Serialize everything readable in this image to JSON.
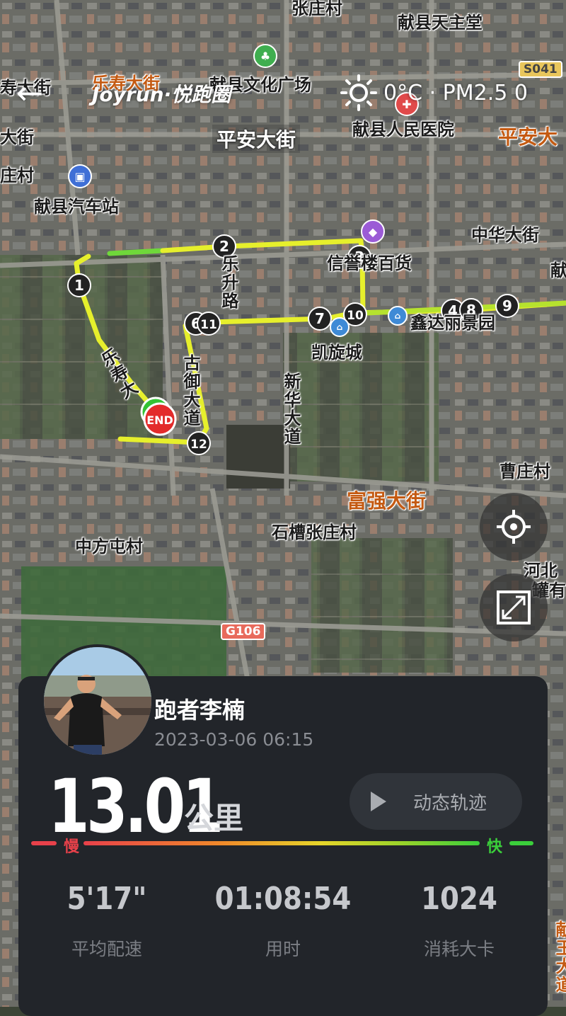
{
  "header": {
    "brand": "Joyrun·悦跑圈",
    "back_icon": "back-arrow-icon",
    "weather": {
      "icon": "sun-icon",
      "text": "0°C · PM2.5 0"
    }
  },
  "map": {
    "labels": {
      "l01": "乐寿大街",
      "l02": "献县文化广场",
      "l03": "献县天主堂",
      "l04": "献县人民医院",
      "l05": "平安大街",
      "l06": "平安大",
      "l07": "献县汽车站",
      "l08": "寿大街",
      "l09": "大街",
      "l10": "庄村",
      "l11": "信誉楼百货",
      "l12": "中华大街",
      "l13": "献",
      "l14": "乐升路",
      "l15": "凯旋城",
      "l16": "鑫达丽景园",
      "l17": "新华大道",
      "l18": "古御大道",
      "l19": "乐寿大",
      "l20": "曹庄村",
      "l21": "富强大街",
      "l22": "石槽张庄村",
      "l23": "中方屯村",
      "l24": "河北",
      "l25": "罐有",
      "l26": "献王大道",
      "l27": "张庄村"
    },
    "road_shields": {
      "s041": "S041",
      "g106": "G106"
    },
    "markers": [
      "1",
      "2",
      "3",
      "4",
      "6",
      "7",
      "8",
      "9",
      "10",
      "11",
      "12"
    ],
    "end_marker": "END",
    "route_colors": {
      "start": "#4cd137",
      "mid": "#f0f02a",
      "fast": "#9fe02e"
    }
  },
  "controls": {
    "locate_icon": "crosshair-icon",
    "expand_icon": "expand-icon"
  },
  "card": {
    "runner_name": "跑者李楠",
    "datetime": "2023-03-06 06:15",
    "distance": "13.01",
    "distance_unit": "公里",
    "replay_label": "动态轨迹",
    "pace_scale": {
      "slow": "慢",
      "fast": "快"
    },
    "stats": [
      {
        "value": "5'17\"",
        "label": "平均配速"
      },
      {
        "value": "01:08:54",
        "label": "用时"
      },
      {
        "value": "1024",
        "label": "消耗大卡"
      }
    ]
  }
}
